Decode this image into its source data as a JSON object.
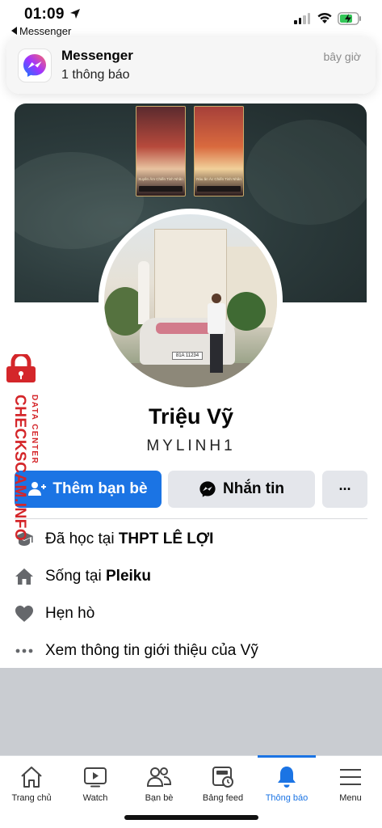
{
  "status_bar": {
    "time": "01:09",
    "back_app": "Messenger",
    "icons": [
      "location-arrow-icon",
      "cellular-signal-icon",
      "wifi-icon",
      "battery-charging-icon"
    ]
  },
  "notification": {
    "app": "Messenger",
    "body": "1 thông báo",
    "time": "bây giờ",
    "icon": "messenger-logo-icon"
  },
  "cover": {
    "cards": [
      {
        "name": "Xuyên Âm Chiến Tinh Nhân",
        "stats": "22.00.00"
      },
      {
        "name": "Ráu ăn Ác Chiến Tinh Nhân",
        "stats": "22.00.00"
      }
    ]
  },
  "avatar": {
    "plate_text": "81A 11234"
  },
  "profile": {
    "name": "Triệu Vỹ",
    "alternate_name": "MYLINH1"
  },
  "actions": {
    "add_friend": "Thêm bạn bè",
    "message": "Nhắn tin",
    "more": "···"
  },
  "intro": {
    "education_prefix": "Đã học tại ",
    "education_school": "THPT LÊ LỢI",
    "lives_prefix": "Sống tại ",
    "lives_city": "Pleiku",
    "dating": "Hẹn hò",
    "see_about": "Xem thông tin giới thiệu của Vỹ"
  },
  "watermark": {
    "brand": "CHECKSCAM.INFO",
    "tagline": "DATA CENTER"
  },
  "tabs": [
    {
      "label": "Trang chủ",
      "icon": "home-icon",
      "active": false
    },
    {
      "label": "Watch",
      "icon": "watch-play-icon",
      "active": false
    },
    {
      "label": "Bạn bè",
      "icon": "friends-icon",
      "active": false
    },
    {
      "label": "Bảng feed",
      "icon": "feeds-icon",
      "active": false
    },
    {
      "label": "Thông báo",
      "icon": "bell-icon",
      "active": true
    },
    {
      "label": "Menu",
      "icon": "hamburger-menu-icon",
      "active": false
    }
  ],
  "colors": {
    "brand_blue": "#1b74e4",
    "button_gray": "#e4e6eb",
    "watermark_red": "#d4262a"
  }
}
